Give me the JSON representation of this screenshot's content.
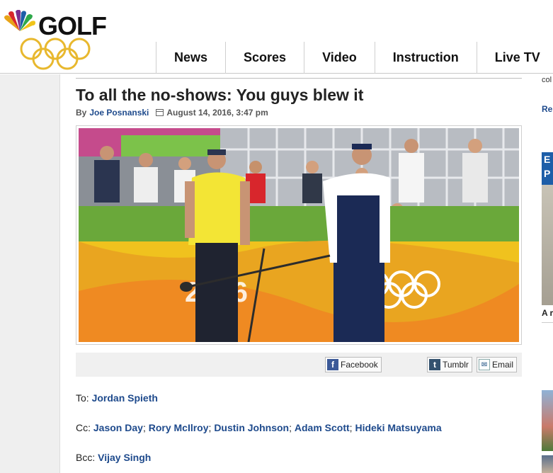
{
  "brand": {
    "logo_text": "GOLF",
    "colors": {
      "accent": "#1e4a8c",
      "nav_text": "#111111",
      "share_bar": "#f0f0f0"
    }
  },
  "nav": {
    "items": [
      {
        "label": "News"
      },
      {
        "label": "Scores"
      },
      {
        "label": "Video"
      },
      {
        "label": "Instruction"
      },
      {
        "label": "Live TV"
      }
    ]
  },
  "article": {
    "title": "To all the no-shows: You guys blew it",
    "byline_prefix": "By",
    "author": "Joe Posnanski",
    "date": "August 14, 2016, 3:47 pm",
    "photo_icon": "rio-2016-golf-photo"
  },
  "share": {
    "facebook": "Facebook",
    "tumblr": "Tumblr",
    "email": "Email"
  },
  "memo": {
    "to_label": "To:",
    "to": [
      "Jordan Spieth"
    ],
    "cc_label": "Cc:",
    "cc": [
      "Jason Day",
      "Rory McIlroy",
      "Dustin Johnson",
      "Adam Scott",
      "Hideki Matsuyama"
    ],
    "bcc_label": "Bcc:",
    "bcc": [
      "Vijay Singh"
    ],
    "separator": "; "
  },
  "right_rail": {
    "snippet": "col",
    "link": "Re",
    "box": "E P",
    "caption": "A r"
  }
}
